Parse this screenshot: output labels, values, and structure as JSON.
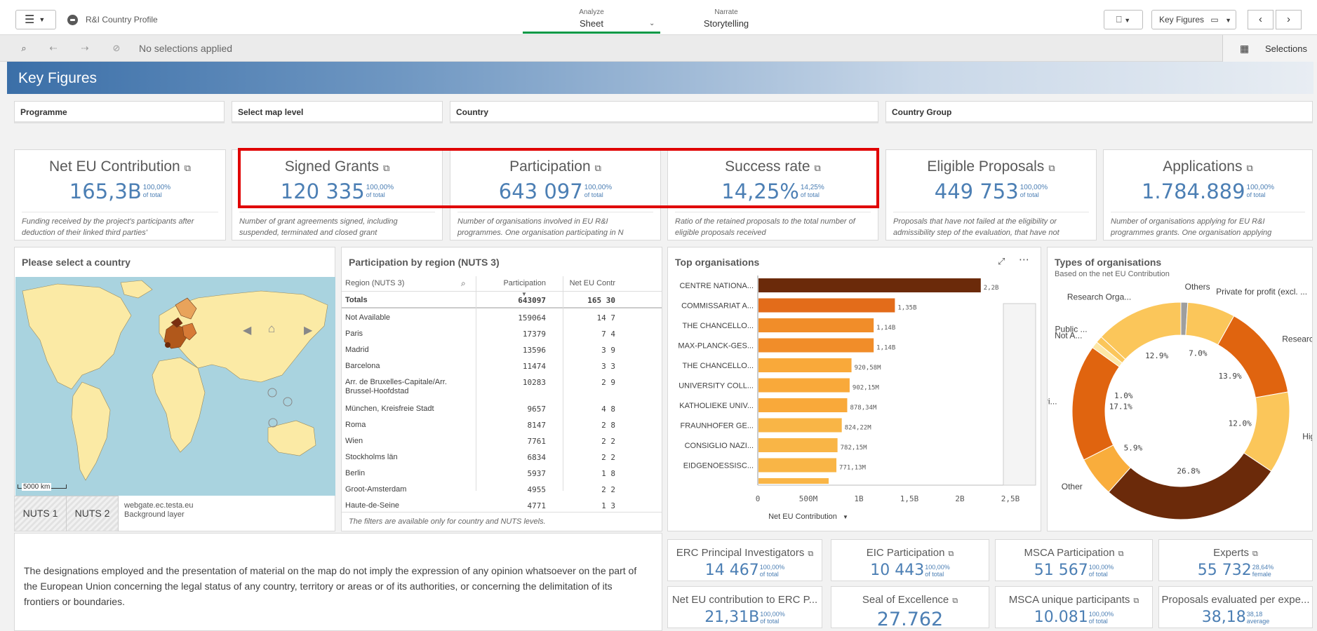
{
  "topbar": {
    "app_title": "R&I Country Profile",
    "tabs": [
      {
        "small": "Analyze",
        "big": "Sheet"
      },
      {
        "small": "Narrate",
        "big": "Storytelling"
      }
    ],
    "sheet_nav_label": "Key Figures"
  },
  "selection_bar": {
    "status": "No selections applied",
    "selections_label": "Selections"
  },
  "sheet_title": "Key Figures",
  "filters": [
    "Programme",
    "Select map level",
    "Country",
    "Country Group"
  ],
  "kpis": [
    {
      "title": "Net EU Contribution",
      "value": "165,3B",
      "sup": "100,00%",
      "sub": "of total",
      "desc": "Funding received by the project's participants after deduction of their linked third parties'"
    },
    {
      "title": "Signed Grants",
      "value": "120 335",
      "sup": "100,00%",
      "sub": "of total",
      "desc": "Number of grant agreements signed, including suspended, terminated and closed grant"
    },
    {
      "title": "Participation",
      "value": "643 097",
      "sup": "100,00%",
      "sub": "of total",
      "desc": "Number of organisations involved in EU R&I programmes. One organisation participating in N"
    },
    {
      "title": "Success rate",
      "value": "14,25%",
      "sup": "14,25%",
      "sub": "of total",
      "desc": "Ratio of the retained proposals to the total number of eligible proposals received"
    },
    {
      "title": "Eligible Proposals",
      "value": "449 753",
      "sup": "100,00%",
      "sub": "of total",
      "desc": "Proposals that have not failed at the eligibility or admissibility step of the evaluation, that have not"
    },
    {
      "title": "Applications",
      "value": "1.784.889",
      "sup": "100,00%",
      "sub": "of total",
      "desc": "Number of organisations applying for EU R&I programmes grants. One organisation applying"
    }
  ],
  "map": {
    "title": "Please select a country",
    "scale_label": "5000 km",
    "levels": [
      "NUTS 1",
      "NUTS 2"
    ],
    "attribution": [
      "webgate.ec.testa.eu",
      "Background layer"
    ]
  },
  "region_table": {
    "title": "Participation by region (NUTS 3)",
    "columns": [
      "Region (NUTS 3)",
      "Participation",
      "Net EU Contr"
    ],
    "totals": {
      "label": "Totals",
      "participation": "643097",
      "net": "165 30"
    },
    "rows": [
      {
        "region": "Not Available",
        "participation": "159064",
        "net": "14 7"
      },
      {
        "region": "Paris",
        "participation": "17379",
        "net": "7 4"
      },
      {
        "region": "Madrid",
        "participation": "13596",
        "net": "3 9"
      },
      {
        "region": "Barcelona",
        "participation": "11474",
        "net": "3 3"
      },
      {
        "region": "Arr. de Bruxelles-Capitale/Arr. Brussel-Hoofdstad",
        "participation": "10283",
        "net": "2 9"
      },
      {
        "region": "München, Kreisfreie Stadt",
        "participation": "9657",
        "net": "4 8"
      },
      {
        "region": "Roma",
        "participation": "8147",
        "net": "2 8"
      },
      {
        "region": "Wien",
        "participation": "7761",
        "net": "2 2"
      },
      {
        "region": "Stockholms län",
        "participation": "6834",
        "net": "2 2"
      },
      {
        "region": "Berlin",
        "participation": "5937",
        "net": "1 8"
      },
      {
        "region": "Groot-Amsterdam",
        "participation": "4955",
        "net": "2 2"
      },
      {
        "region": "Haute-de-Seine",
        "participation": "4771",
        "net": "1 3"
      }
    ],
    "footnote": "The filters are available only for country and NUTS levels."
  },
  "top_orgs": {
    "title": "Top organisations",
    "xlabel": "Net EU Contribution"
  },
  "types_orgs": {
    "title": "Types of organisations",
    "subtitle": "Based on the net EU Contribution"
  },
  "chart_data": [
    {
      "type": "bar",
      "orientation": "horizontal",
      "title": "Top organisations",
      "xlabel": "Net EU Contribution",
      "categories": [
        "CENTRE NATIONA...",
        "COMMISSARIAT A...",
        "THE CHANCELLO...",
        "MAX-PLANCK-GES...",
        "THE CHANCELLO...",
        "UNIVERSITY COLL...",
        "KATHOLIEKE UNIV...",
        "FRAUNHOFER GE...",
        "CONSIGLIO NAZI...",
        "EIDGENOESSISC..."
      ],
      "values": [
        2200000000,
        1350000000,
        1140000000,
        1140000000,
        920580000,
        902150000,
        878340000,
        824220000,
        782150000,
        771130000
      ],
      "data_labels": [
        "2,2B",
        "1,35B",
        "1,14B",
        "1,14B",
        "920,58M",
        "902,15M",
        "878,34M",
        "824,22M",
        "782,15M",
        "771,13M"
      ],
      "xticks": [
        "0",
        "500M",
        "1B",
        "1,5B",
        "2B",
        "2,5B"
      ],
      "xlim": [
        0,
        2500000000
      ],
      "colors": [
        "#6b2a0a",
        "#e36c1a",
        "#f18d29",
        "#f18d29",
        "#f9a93a",
        "#f9a93a",
        "#f9a93a",
        "#f9b546",
        "#f9b546",
        "#f9b546"
      ]
    },
    {
      "type": "pie",
      "title": "Types of organisations",
      "subtitle": "Based on the net EU Contribution",
      "slices": [
        {
          "label": "Others",
          "value": 1.0,
          "color": "#9e9e9e"
        },
        {
          "label": "Private for profit (excl. ...",
          "value": 7.0,
          "color": "#fbc65a"
        },
        {
          "label": "Researc...",
          "value": 13.9,
          "color": "#e0640f"
        },
        {
          "label": "Hig...",
          "value": 12.0,
          "color": "#fbc65a"
        },
        {
          "label": "Higher or Secondary ...",
          "value": 26.8,
          "color": "#6b2a0a"
        },
        {
          "label": "Other",
          "value": 5.9,
          "color": "#f9ad3c"
        },
        {
          "label": "Pri...",
          "value": 17.1,
          "color": "#e0640f"
        },
        {
          "label": "Not A...",
          "value": 1.0,
          "color": "#fde7a6"
        },
        {
          "label": "Public ...",
          "value": 1.0,
          "color": "#fbc65a"
        },
        {
          "label": "Research Orga...",
          "value": 12.9,
          "color": "#fbc65a"
        }
      ],
      "pct_labels": [
        "7.0%",
        "13.9%",
        "12.0%",
        "26.8%",
        "5.9%",
        "17.1%",
        "1.0%",
        "12.9%"
      ]
    }
  ],
  "bottom_kpis": [
    {
      "title": "ERC Principal Investigators",
      "value": "14 467",
      "sup": "100,00%",
      "sub": "of total",
      "ext": true
    },
    {
      "title": "EIC Participation",
      "value": "10 443",
      "sup": "100,00%",
      "sub": "of total",
      "ext": true
    },
    {
      "title": "MSCA Participation",
      "value": "51 567",
      "sup": "100,00%",
      "sub": "of total",
      "ext": true
    },
    {
      "title": "Experts",
      "value": "55 732",
      "sup": "28,64%",
      "sub": "female",
      "ext": true
    },
    {
      "title": "Net EU contribution to ERC P...",
      "value": "21,31B",
      "sup": "100,00%",
      "sub": "of total",
      "ext": false
    },
    {
      "title": "Seal of Excellence",
      "value": "27.762",
      "sup": "",
      "sub": "",
      "ext": true
    },
    {
      "title": "MSCA unique participants",
      "value": "10.081",
      "sup": "100,00%",
      "sub": "of total",
      "ext": true
    },
    {
      "title": "Proposals evaluated per expe...",
      "value": "38,18",
      "sup": "38,18",
      "sub": "average",
      "ext": false
    }
  ],
  "disclaimer": "The designations employed and the presentation of material on the map do not imply the expression of any opinion whatsoever on the part of the European Union concerning the legal status of any country, territory or areas or of its authorities, or concerning the delimitation of its frontiers or boundaries."
}
